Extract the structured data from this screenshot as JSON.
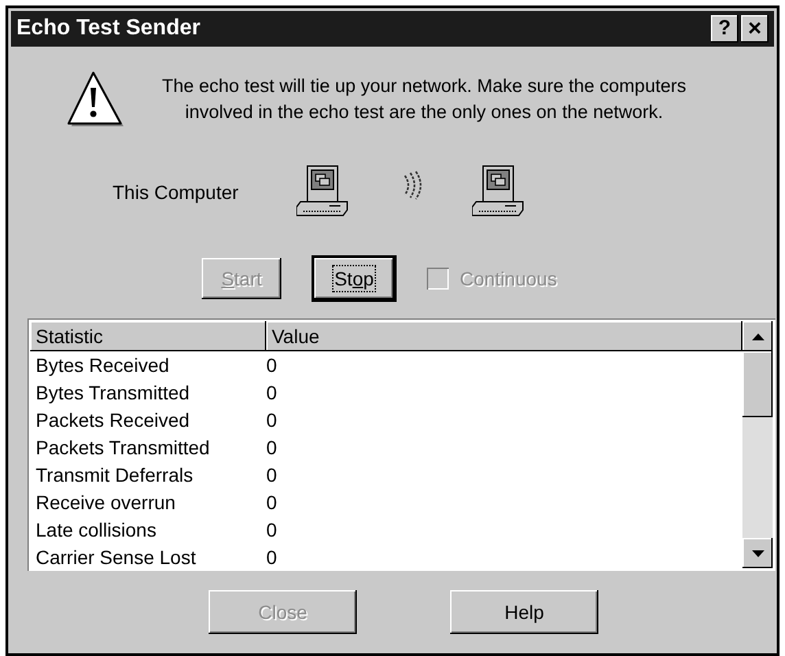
{
  "window": {
    "title": "Echo Test Sender",
    "title_buttons": [
      {
        "kind": "help",
        "label": "?"
      },
      {
        "kind": "close",
        "label": "×"
      }
    ]
  },
  "warning": {
    "text": "The echo test will tie up your network.  Make sure the computers involved in the echo test are the only ones on the network."
  },
  "computer_label": "This Computer",
  "controls": [
    {
      "kind": "button",
      "label_parts": [
        {
          "text": "S",
          "underlined": true
        },
        {
          "text": "tart",
          "underlined": false
        }
      ],
      "disabled": true,
      "focused": false
    },
    {
      "kind": "button",
      "label_parts": [
        {
          "text": "St",
          "underlined": false
        },
        {
          "text": "o",
          "underlined": true
        },
        {
          "text": "p",
          "underlined": false
        }
      ],
      "disabled": false,
      "focused": true
    },
    {
      "kind": "checkbox",
      "label": "Continuous",
      "disabled": true,
      "checked": false
    }
  ],
  "table": {
    "columns": [
      "Statistic",
      "Value"
    ],
    "rows": [
      {
        "statistic": "Bytes Received",
        "value": "0"
      },
      {
        "statistic": "Bytes Transmitted",
        "value": "0"
      },
      {
        "statistic": "Packets Received",
        "value": "0"
      },
      {
        "statistic": "Packets Transmitted",
        "value": "0"
      },
      {
        "statistic": "Transmit Deferrals",
        "value": "0"
      },
      {
        "statistic": "Receive overrun",
        "value": "0"
      },
      {
        "statistic": "Late collisions",
        "value": "0"
      },
      {
        "statistic": "Carrier Sense Lost",
        "value": "0"
      }
    ]
  },
  "buttons": [
    {
      "label": "Close",
      "disabled": true
    },
    {
      "label": "Help",
      "disabled": false
    }
  ]
}
